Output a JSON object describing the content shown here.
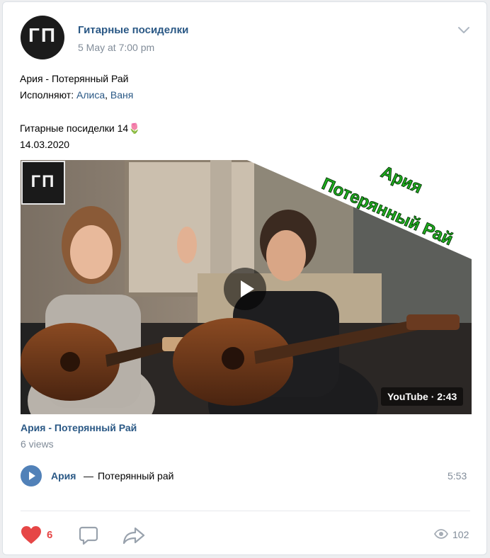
{
  "post": {
    "group_name": "Гитарные посиделки",
    "date": "5 May at 7:00 pm",
    "avatar_text": "ГП",
    "line1": "Ария - Потерянный Рай",
    "performers_prefix": "Исполняют: ",
    "performer1": "Алиса",
    "comma": ", ",
    "performer2": "Ваня",
    "line3": "Гитарные посиделки 14",
    "emoji": "🌷",
    "line4": "14.03.2020"
  },
  "video": {
    "overlay_logo_text": "ГП",
    "overlay_line1": "Ария",
    "overlay_line2": "Потерянный Рай",
    "badge": "YouTube · 2:43",
    "title": "Ария - Потерянный Рай",
    "views": "6 views"
  },
  "audio": {
    "artist": "Ария",
    "dash": "—",
    "title": "Потерянный рай",
    "duration": "5:53"
  },
  "actions": {
    "likes": "6",
    "views": "102"
  },
  "colors": {
    "link": "#2a5885",
    "secondary": "#818c99",
    "like": "#e64646",
    "accent": "#5181b8",
    "overlay_green": "#1fb21f"
  },
  "icons": [
    "chevron-down-icon",
    "play-icon",
    "heart-icon",
    "comment-icon",
    "share-icon",
    "eye-icon"
  ]
}
